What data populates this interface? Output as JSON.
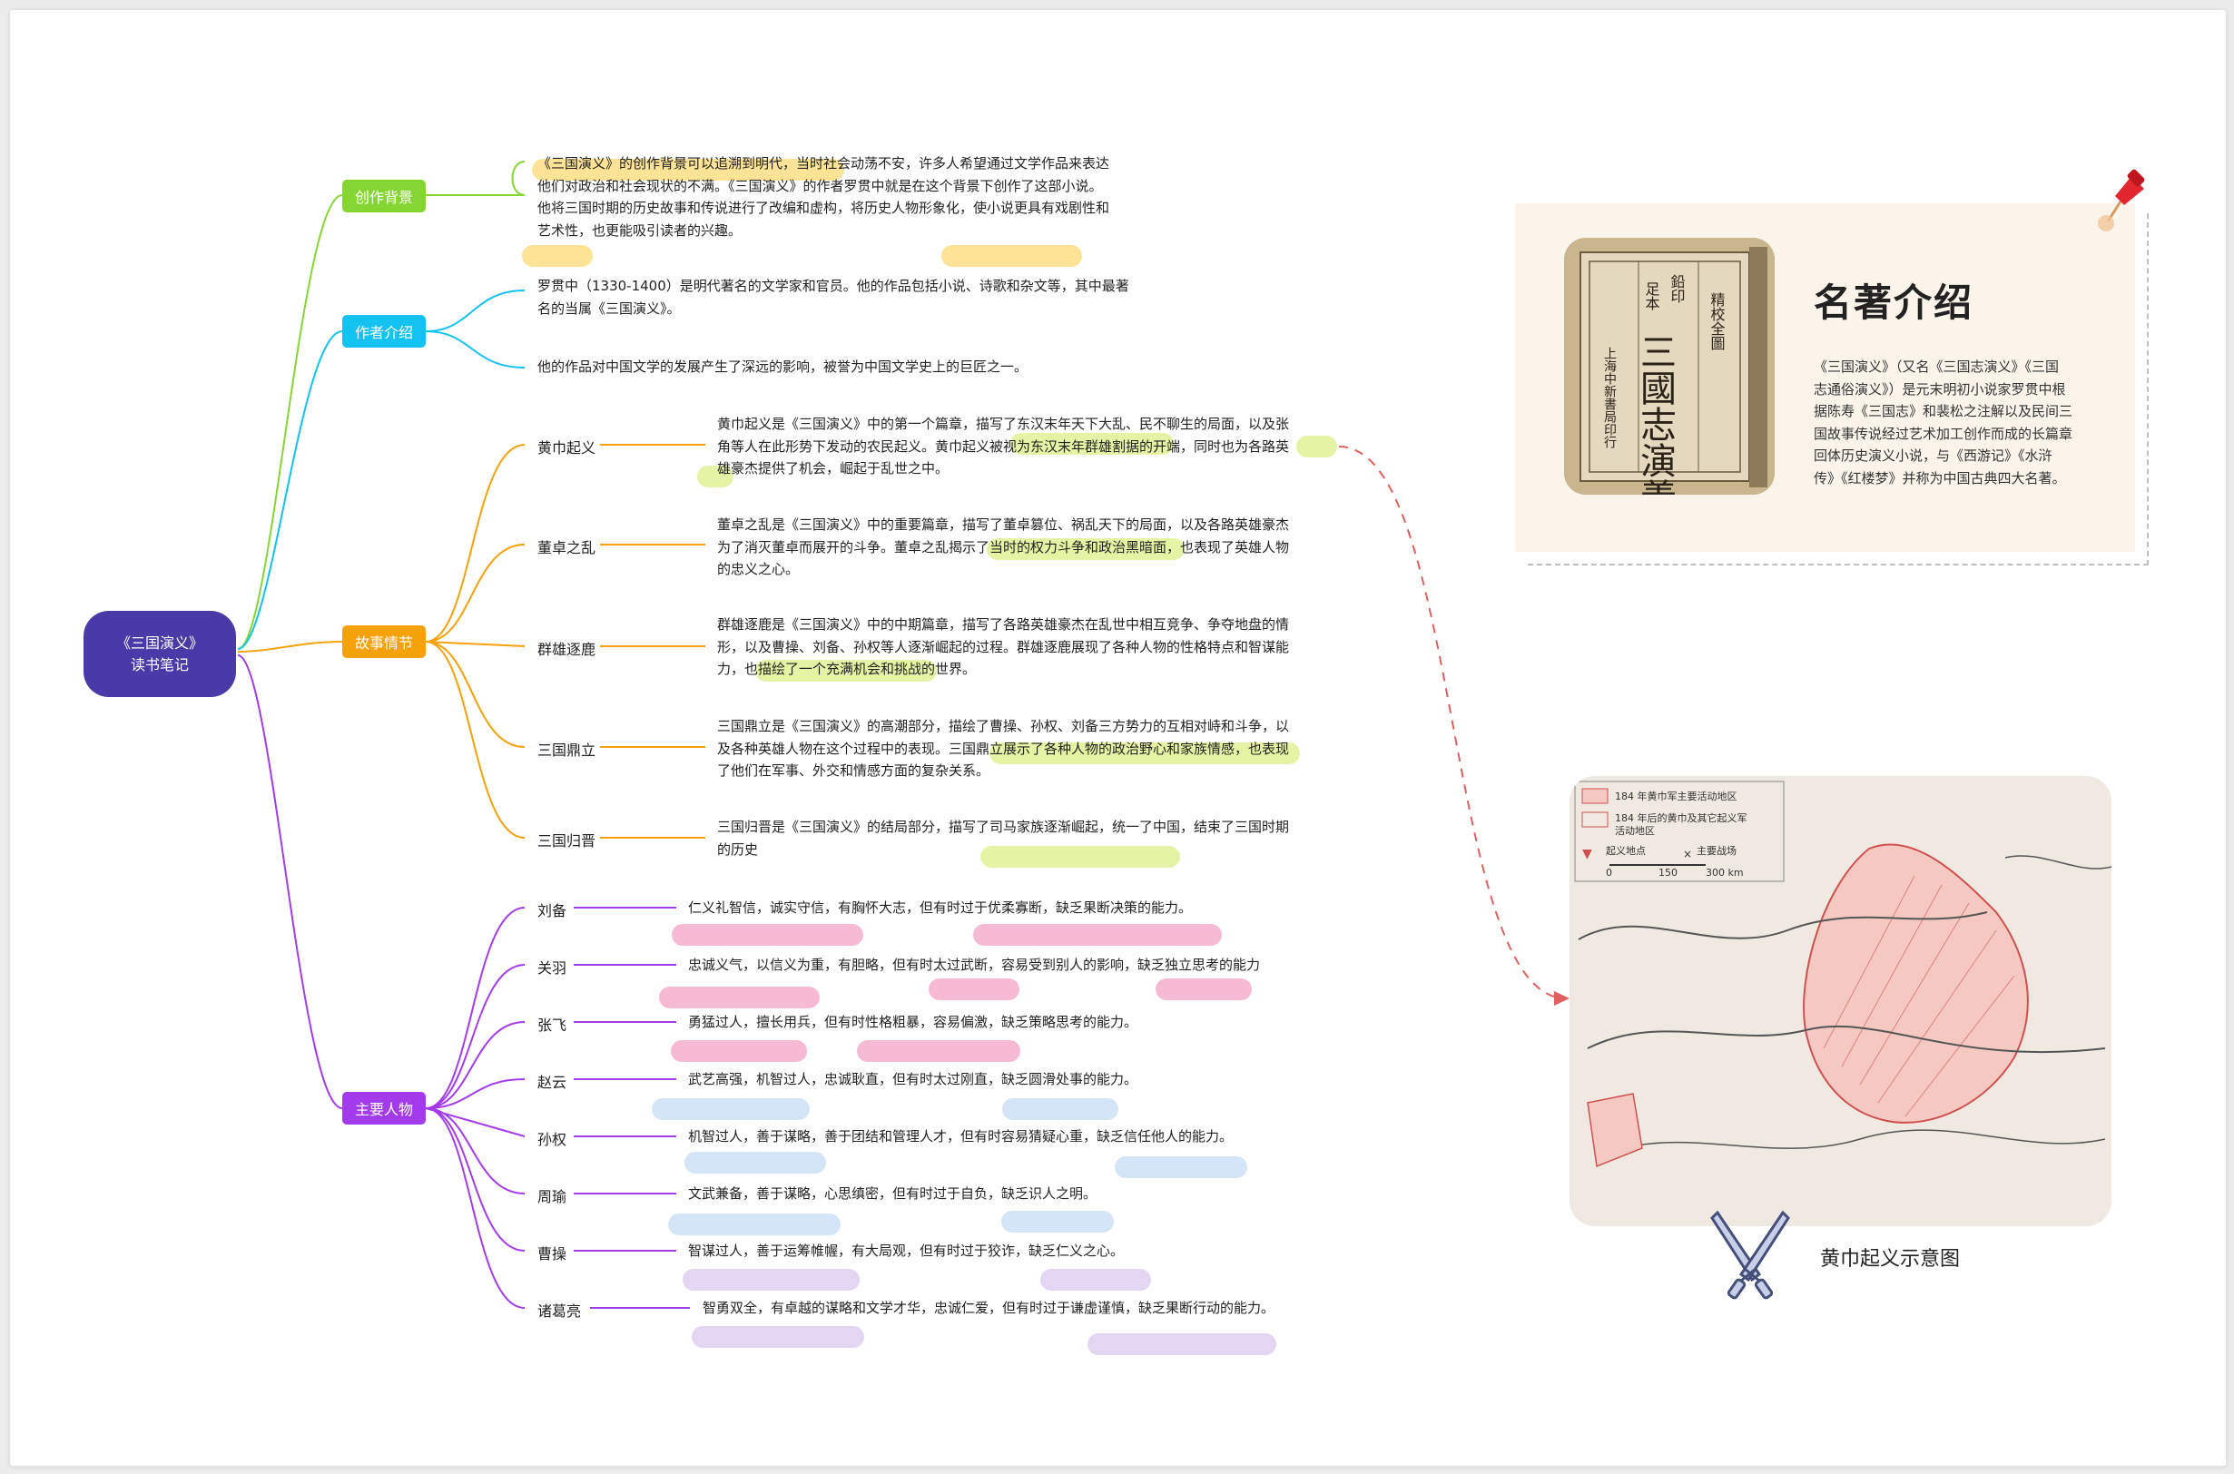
{
  "root": {
    "line1": "《三国演义》",
    "line2": "读书笔记"
  },
  "branches": {
    "background": {
      "label": "创作背景",
      "color": "#86d633",
      "lines": [
        "《三国演义》的创作背景可以追溯到明代，当时社会动荡不安，许多人希望通过文学作品来表达",
        "他们对政治和社会现状的不满。《三国演义》的作者罗贯中就是在这个背景下创作了这部小说。",
        "他将三国时期的历史故事和传说进行了改编和虚构，将历史人物形象化，使小说更具有戏剧性和",
        "艺术性，也更能吸引读者的兴趣。"
      ]
    },
    "author": {
      "label": "作者介绍",
      "color": "#13c2f0",
      "items": [
        {
          "lines": [
            "罗贯中（1330-1400）是明代著名的文学家和官员。他的作品包括小说、诗歌和杂文等，其中最著",
            "名的当属《三国演义》。"
          ]
        },
        {
          "lines": [
            "他的作品对中国文学的发展产生了深远的影响，被誉为中国文学史上的巨匠之一。"
          ]
        }
      ]
    },
    "plot": {
      "label": "故事情节",
      "color": "#f5a10a",
      "items": [
        {
          "title": "黄巾起义",
          "lines": [
            "黄巾起义是《三国演义》中的第一个篇章，描写了东汉末年天下大乱、民不聊生的局面，以及张",
            "角等人在此形势下发动的农民起义。黄巾起义被视为东汉末年群雄割据的开端，同时也为各路英",
            "雄豪杰提供了机会，崛起于乱世之中。"
          ]
        },
        {
          "title": "董卓之乱",
          "lines": [
            "董卓之乱是《三国演义》中的重要篇章，描写了董卓篡位、祸乱天下的局面，以及各路英雄豪杰",
            "为了消灭董卓而展开的斗争。董卓之乱揭示了当时的权力斗争和政治黑暗面，也表现了英雄人物",
            "的忠义之心。"
          ]
        },
        {
          "title": "群雄逐鹿",
          "lines": [
            "群雄逐鹿是《三国演义》中的中期篇章，描写了各路英雄豪杰在乱世中相互竞争、争夺地盘的情",
            "形，以及曹操、刘备、孙权等人逐渐崛起的过程。群雄逐鹿展现了各种人物的性格特点和智谋能",
            "力，也描绘了一个充满机会和挑战的世界。"
          ]
        },
        {
          "title": "三国鼎立",
          "lines": [
            "三国鼎立是《三国演义》的高潮部分，描绘了曹操、孙权、刘备三方势力的互相对峙和斗争，以",
            "及各种英雄人物在这个过程中的表现。三国鼎立展示了各种人物的政治野心和家族情感，也表现",
            "了他们在军事、外交和情感方面的复杂关系。"
          ]
        },
        {
          "title": "三国归晋",
          "lines": [
            "三国归晋是《三国演义》的结局部分，描写了司马家族逐渐崛起，统一了中国，结束了三国时期",
            "的历史"
          ]
        }
      ]
    },
    "characters": {
      "label": "主要人物",
      "color": "#a43bea",
      "items": [
        {
          "name": "刘备",
          "desc": "仁义礼智信，诚实守信，有胸怀大志，但有时过于优柔寡断，缺乏果断决策的能力。"
        },
        {
          "name": "关羽",
          "desc": "忠诚义气，以信义为重，有胆略，但有时太过武断，容易受到别人的影响，缺乏独立思考的能力"
        },
        {
          "name": "张飞",
          "desc": "勇猛过人，擅长用兵，但有时性格粗暴，容易偏激，缺乏策略思考的能力。"
        },
        {
          "name": "赵云",
          "desc": "武艺高强，机智过人，忠诚耿直，但有时太过刚直，缺乏圆滑处事的能力。"
        },
        {
          "name": "孙权",
          "desc": "机智过人，善于谋略，善于团结和管理人才，但有时容易猜疑心重，缺乏信任他人的能力。"
        },
        {
          "name": "周瑜",
          "desc": "文武兼备，善于谋略，心思缜密，但有时过于自负，缺乏识人之明。"
        },
        {
          "name": "曹操",
          "desc": "智谋过人，善于运筹帷幄，有大局观，但有时过于狡诈，缺乏仁义之心。"
        },
        {
          "name": "诸葛亮",
          "desc": "智勇双全，有卓越的谋略和文学才华，忠诚仁爱，但有时过于谦虚谨慎，缺乏果断行动的能力。"
        }
      ]
    }
  },
  "intro_card": {
    "title": "名著介绍",
    "lines": [
      "《三国演义》（又名《三国志演义》《三国",
      "志通俗演义》）是元末明初小说家罗贯中根",
      "据陈寿《三国志》和裴松之注解以及民间三",
      "国故事传说经过艺术加工创作而成的长篇章",
      "回体历史演义小说，与《西游记》《水浒",
      "传》《红楼梦》并称为中国古典四大名著。"
    ],
    "book_cover": {
      "top_small": "足本",
      "top_small2": "鉛印",
      "title": "三國志演義",
      "right": "精校全圖",
      "publisher": "上海中新書局印行"
    }
  },
  "map_card": {
    "caption": "黄巾起义示意图",
    "legend": [
      "184 年黄巾军主要活动地区",
      "184 年后的黄巾及其它起义军",
      "活动地区",
      "起义地点",
      "主要战场"
    ],
    "scale": [
      "0",
      "150",
      "300 km"
    ]
  },
  "highlight_colors": {
    "orange": "#fde08a",
    "green": "#e2f39a",
    "pink": "#f5b2d0",
    "blue": "#cfe2f7",
    "purple": "#e0d2f2"
  }
}
